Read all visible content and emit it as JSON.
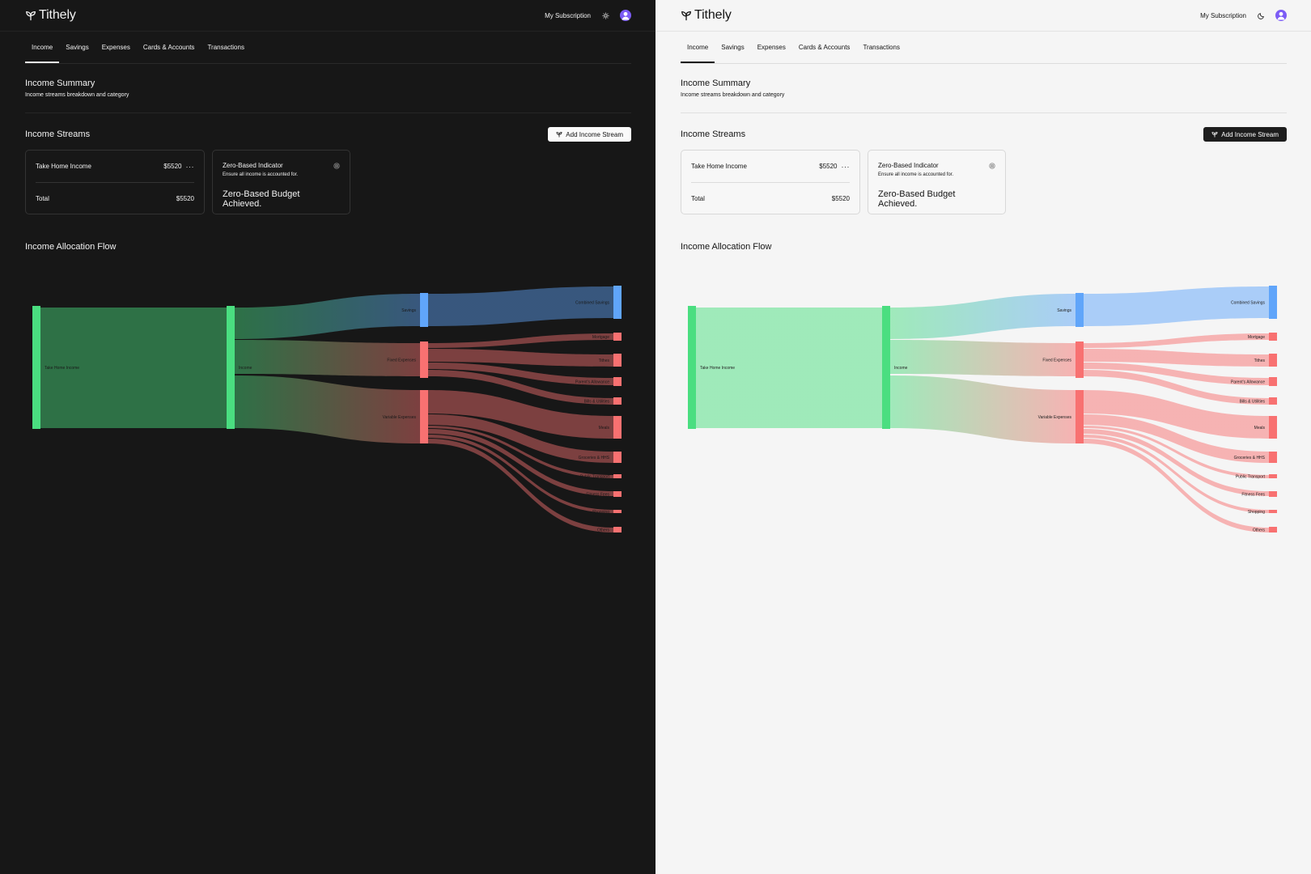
{
  "app": {
    "name": "Tithely"
  },
  "header": {
    "subscription_label": "My Subscription"
  },
  "tabs": [
    {
      "label": "Income",
      "active": true
    },
    {
      "label": "Savings",
      "active": false
    },
    {
      "label": "Expenses",
      "active": false
    },
    {
      "label": "Cards & Accounts",
      "active": false
    },
    {
      "label": "Transactions",
      "active": false
    }
  ],
  "summary": {
    "title": "Income Summary",
    "subtitle": "Income streams breakdown and category"
  },
  "streams": {
    "title": "Income Streams",
    "add_button": "Add Income Stream",
    "income_card": {
      "name": "Take Home Income",
      "amount": "$5520",
      "total_label": "Total",
      "total_amount": "$5520"
    },
    "zero_card": {
      "title": "Zero-Based Indicator",
      "subtitle": "Ensure all income is accounted for.",
      "status": "Zero-Based Budget Achieved."
    }
  },
  "flow": {
    "title": "Income Allocation Flow",
    "nodes": [
      {
        "id": "take_home",
        "label": "Take Home Income",
        "color": "#4ade80"
      },
      {
        "id": "income",
        "label": "Income",
        "color": "#4ade80"
      },
      {
        "id": "savings",
        "label": "Savings",
        "color": "#60a5fa"
      },
      {
        "id": "fixed",
        "label": "Fixed Expenses",
        "color": "#f87171"
      },
      {
        "id": "variable",
        "label": "Variable Expenses",
        "color": "#f87171"
      },
      {
        "id": "combined",
        "label": "Combined Savings",
        "color": "#60a5fa"
      },
      {
        "id": "mortgage",
        "label": "Mortgage",
        "color": "#f87171"
      },
      {
        "id": "tithes",
        "label": "Tithes",
        "color": "#f87171"
      },
      {
        "id": "parents",
        "label": "Parent's Allowance",
        "color": "#f87171"
      },
      {
        "id": "bills",
        "label": "Bills & Utilities",
        "color": "#f87171"
      },
      {
        "id": "meals",
        "label": "Meals",
        "color": "#f87171"
      },
      {
        "id": "groceries",
        "label": "Groceries & HHS",
        "color": "#f87171"
      },
      {
        "id": "transport",
        "label": "Public Transport",
        "color": "#f87171"
      },
      {
        "id": "fitness",
        "label": "Fitness Fees",
        "color": "#f87171"
      },
      {
        "id": "shopping",
        "label": "Shopping",
        "color": "#f87171"
      },
      {
        "id": "others",
        "label": "Others",
        "color": "#f87171"
      }
    ]
  },
  "colors": {
    "green": "#4ade80",
    "blue": "#60a5fa",
    "red": "#f87171",
    "avatar": "#7c5cf5"
  }
}
